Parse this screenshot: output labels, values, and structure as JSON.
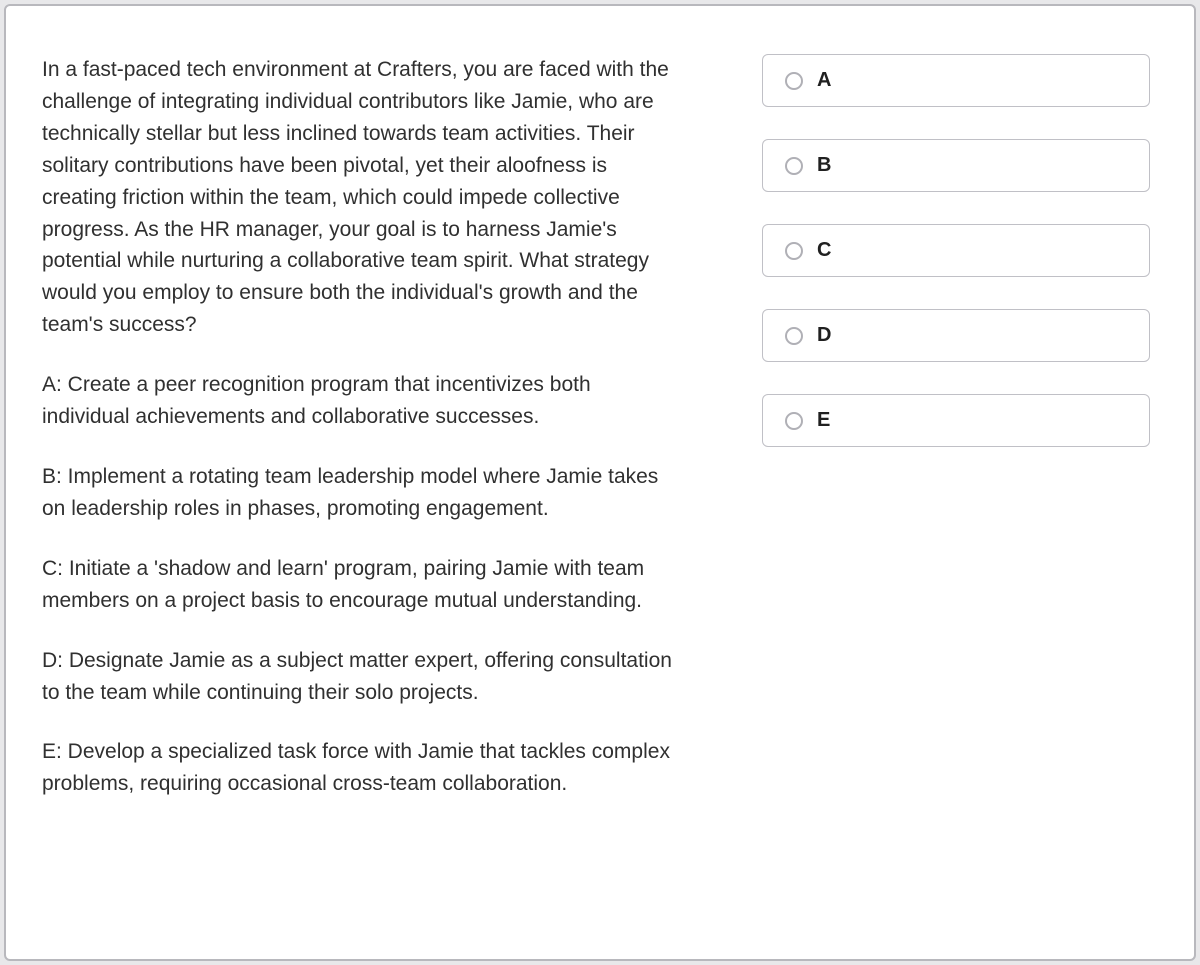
{
  "question": {
    "prompt": "In a fast-paced tech environment at Crafters, you are faced with the challenge of integrating individual contributors like Jamie, who are technically stellar but less inclined towards team activities. Their solitary contributions have been pivotal, yet their aloofness is creating friction within the team, which could impede collective progress. As the HR manager, your goal is to harness Jamie's potential while nurturing a collaborative team spirit. What strategy would you employ to ensure both the individual's growth and the team's success?",
    "answers": [
      {
        "key": "A",
        "text": "A: Create a peer recognition program that incentivizes both individual achievements and collaborative successes."
      },
      {
        "key": "B",
        "text": "B: Implement a rotating team leadership model where Jamie takes on leadership roles in phases, promoting engagement."
      },
      {
        "key": "C",
        "text": "C: Initiate a 'shadow and learn' program, pairing Jamie with team members on a project basis to encourage mutual understanding."
      },
      {
        "key": "D",
        "text": "D: Designate Jamie as a subject matter expert, offering consultation to the team while continuing their solo projects."
      },
      {
        "key": "E",
        "text": "E: Develop a specialized task force with Jamie that tackles complex problems, requiring occasional cross-team collaboration."
      }
    ]
  },
  "options": [
    {
      "label": "A"
    },
    {
      "label": "B"
    },
    {
      "label": "C"
    },
    {
      "label": "D"
    },
    {
      "label": "E"
    }
  ]
}
